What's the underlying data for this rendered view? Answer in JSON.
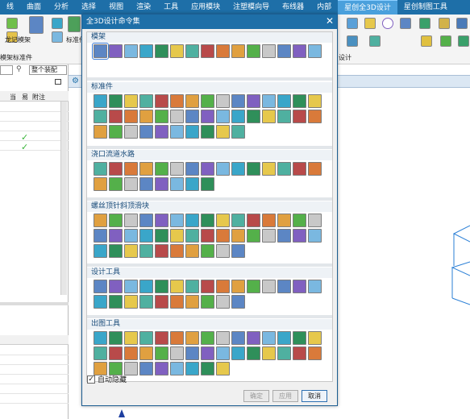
{
  "menubar": {
    "items": [
      "线",
      "曲面",
      "分析",
      "选择",
      "视图",
      "渲染",
      "工具",
      "应用模块",
      "注塑模向导",
      "布线器",
      "内部",
      "星创全3D设计",
      "星创制图工具"
    ],
    "active_index": 11
  },
  "ribbon": {
    "labels": [
      "龙记模架",
      "模架标准件",
      "标准件",
      "设计"
    ]
  },
  "left_panel": {
    "combo_right": "整个装配",
    "columns": [
      "当",
      "易",
      "附注"
    ]
  },
  "dialog": {
    "title": "全3D设计命令集",
    "close_glyph": "✕",
    "sections": [
      {
        "name": "模架",
        "count": 15
      },
      {
        "name": "标准件",
        "count": 40
      },
      {
        "name": "浇口流道水路",
        "count": 23
      },
      {
        "name": "螺丝顶针斜顶滑块",
        "count": 40
      },
      {
        "name": "设计工具",
        "count": 25
      },
      {
        "name": "出图工具",
        "count": 39
      }
    ],
    "auto_hide_label": "自动隐藏",
    "auto_hide_checked": true,
    "auto_hide_glyph": "✓",
    "buttons": {
      "ok": "确定",
      "apply": "应用",
      "cancel": "取消"
    }
  },
  "colors": {
    "title_bar": "#1e6fa8",
    "accent": "#4aa0dc"
  }
}
